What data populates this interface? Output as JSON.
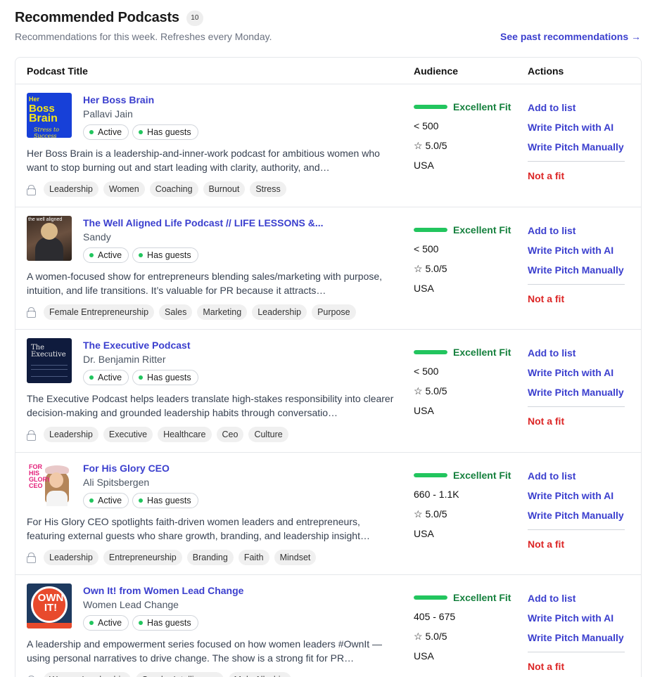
{
  "header": {
    "title": "Recommended Podcasts",
    "count": "10",
    "subtitle": "Recommendations for this week. Refreshes every Monday.",
    "past_link": "See past recommendations →"
  },
  "table": {
    "col_title": "Podcast Title",
    "col_audience": "Audience",
    "col_actions": "Actions"
  },
  "actions": {
    "add": "Add to list",
    "ai": "Write Pitch with AI",
    "manual": "Write Pitch Manually",
    "notfit": "Not a fit"
  },
  "rows": [
    {
      "title": "Her Boss Brain",
      "host": "Pallavi Jain",
      "status": "Active",
      "guests": "Has guests",
      "description": "Her Boss Brain is a leadership-and-inner-work podcast for ambitious women who want to stop burning out and start leading with clarity, authority, and…",
      "tags": [
        "Leadership",
        "Women",
        "Coaching",
        "Burnout",
        "Stress"
      ],
      "fit": "Excellent Fit",
      "fit_level": 1.0,
      "audience": "< 500",
      "rating": "☆ 5.0/5",
      "country": "USA",
      "cover": {
        "l1": "Her",
        "l2": "Boss",
        "l3": "Brain",
        "l4": "Stress to Success"
      }
    },
    {
      "title": "The Well Aligned Life Podcast // LIFE LESSONS &...",
      "host": "Sandy",
      "status": "Active",
      "guests": "Has guests",
      "description": "A women-focused show for entrepreneurs blending sales/marketing with purpose, intuition, and life transitions. It’s valuable for PR because it attracts…",
      "tags": [
        "Female Entrepreneurship",
        "Sales",
        "Marketing",
        "Leadership",
        "Purpose"
      ],
      "fit": "Excellent Fit",
      "fit_level": 1.0,
      "audience": "< 500",
      "rating": "☆ 5.0/5",
      "country": "USA",
      "cover": {
        "text": "the well aligned"
      }
    },
    {
      "title": "The Executive Podcast",
      "host": "Dr. Benjamin Ritter",
      "status": "Active",
      "guests": "Has guests",
      "description": "The Executive Podcast helps leaders translate high-stakes responsibility into clearer decision-making and grounded leadership habits through conversatio…",
      "tags": [
        "Leadership",
        "Executive",
        "Healthcare",
        "Ceo",
        "Culture"
      ],
      "fit": "Excellent Fit",
      "fit_level": 1.0,
      "audience": "< 500",
      "rating": "☆ 5.0/5",
      "country": "USA",
      "cover": {
        "l1": "The",
        "l2": "Executive"
      }
    },
    {
      "title": "For His Glory CEO",
      "host": "Ali Spitsbergen",
      "status": "Active",
      "guests": "Has guests",
      "description": "For His Glory CEO spotlights faith-driven women leaders and entrepreneurs, featuring external guests who share growth, branding, and leadership insight…",
      "tags": [
        "Leadership",
        "Entrepreneurship",
        "Branding",
        "Faith",
        "Mindset"
      ],
      "fit": "Excellent Fit",
      "fit_level": 1.0,
      "audience": "660 - 1.1K",
      "rating": "☆ 5.0/5",
      "country": "USA",
      "cover": {
        "text": "FOR HIS GLORY CEO"
      }
    },
    {
      "title": "Own It! from Women Lead Change",
      "host": "Women Lead Change",
      "status": "Active",
      "guests": "Has guests",
      "description": "A leadership and empowerment series focused on how women leaders #OwnIt —using personal narratives to drive change. The show is a strong fit for PR…",
      "tags": [
        "Women Leadership",
        "Gender Intelligence",
        "Male Allyship"
      ],
      "fit": "Excellent Fit",
      "fit_level": 1.0,
      "audience": "405 - 675",
      "rating": "☆ 5.0/5",
      "country": "USA",
      "cover": {
        "text": "OWN IT!"
      }
    }
  ],
  "colors": {
    "link": "#3b3fce",
    "fit": "#15803d",
    "fit_bar": "#22c55e",
    "notfit": "#dc2626"
  }
}
